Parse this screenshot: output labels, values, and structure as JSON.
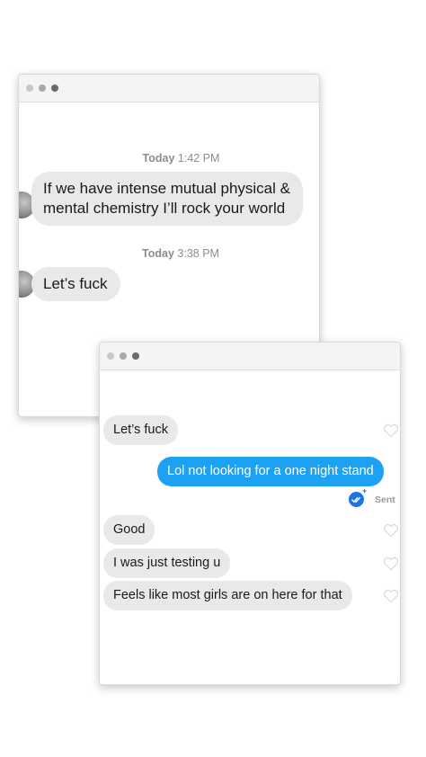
{
  "colors": {
    "received_bubble": "#e9e9eb",
    "sent_bubble": "#1da1f2",
    "read_receipt": "#1d73e8",
    "window_dots": [
      "#c8c8c8",
      "#a8a8a8",
      "#6a6a6a"
    ]
  },
  "window1": {
    "messages": [
      {
        "timestamp_day": "Today",
        "timestamp_time": "1:42 PM",
        "line1": "If we have intense mutual physical &",
        "line2": "mental chemistry I’ll rock your world"
      },
      {
        "timestamp_day": "Today",
        "timestamp_time": "3:38 PM",
        "text": "Let’s fuck"
      }
    ]
  },
  "window2": {
    "messages": [
      {
        "direction": "received",
        "text": "Let’s fuck",
        "icon": "heart-icon"
      },
      {
        "direction": "sent",
        "text": "Lol not looking for a one night stand",
        "receipt_icon": "double-check-icon",
        "status": "Sent"
      },
      {
        "direction": "received",
        "text": "Good",
        "icon": "heart-icon"
      },
      {
        "direction": "received",
        "text": "I was just testing u",
        "icon": "heart-icon"
      },
      {
        "direction": "received",
        "text": "Feels like most girls are on here for that",
        "icon": "heart-icon"
      }
    ]
  }
}
